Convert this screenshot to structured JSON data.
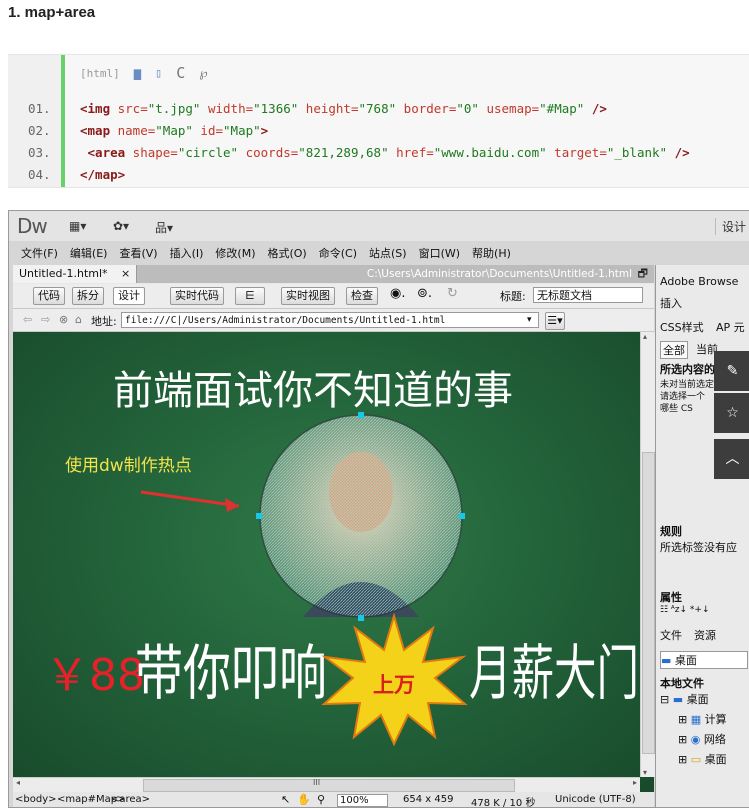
{
  "article": {
    "heading": "1. map+area",
    "code_toolbar": {
      "lang_label": "[html]"
    },
    "code_lines": [
      {
        "num": "01.",
        "parts": [
          [
            "t",
            "<img"
          ],
          [
            "a",
            " src="
          ],
          [
            "v",
            "\"t.jpg\""
          ],
          [
            "a",
            " width="
          ],
          [
            "v",
            "\"1366\""
          ],
          [
            "a",
            " height="
          ],
          [
            "v",
            "\"768\""
          ],
          [
            "a",
            " border="
          ],
          [
            "v",
            "\"0\""
          ],
          [
            "a",
            " usemap="
          ],
          [
            "v",
            "\"#Map\""
          ],
          [
            "t",
            " />"
          ]
        ]
      },
      {
        "num": "02.",
        "parts": [
          [
            "t",
            "<map"
          ],
          [
            "a",
            " name="
          ],
          [
            "v",
            "\"Map\""
          ],
          [
            "a",
            " id="
          ],
          [
            "v",
            "\"Map\""
          ],
          [
            "t",
            ">"
          ]
        ]
      },
      {
        "num": "03.",
        "parts": [
          [
            "t",
            " <area"
          ],
          [
            "a",
            " shape="
          ],
          [
            "v",
            "\"circle\""
          ],
          [
            "a",
            " coords="
          ],
          [
            "v",
            "\"821,289,68\""
          ],
          [
            "a",
            " href="
          ],
          [
            "v",
            "\"www.baidu.com\""
          ],
          [
            "a",
            " target="
          ],
          [
            "v",
            "\"_blank\""
          ],
          [
            "t",
            " />"
          ]
        ]
      },
      {
        "num": "04.",
        "parts": [
          [
            "t",
            "</map>"
          ]
        ]
      }
    ]
  },
  "dw": {
    "logo": "Dw",
    "top_tools": [
      "▦▾",
      "✿▾",
      "品▾"
    ],
    "top_right": "设计",
    "menu": [
      "文件(F)",
      "编辑(E)",
      "查看(V)",
      "插入(I)",
      "修改(M)",
      "格式(O)",
      "命令(C)",
      "站点(S)",
      "窗口(W)",
      "帮助(H)"
    ],
    "doc_tab": "Untitled-1.html*",
    "doc_tab_close": "×",
    "doc_path": "C:\\Users\\Administrator\\Documents\\Untitled-1.html",
    "view_buttons": [
      "代码",
      "拆分",
      "设计",
      "实时代码",
      "实时视图",
      "检查"
    ],
    "title_label": "标题:",
    "title_value": "无标题文档",
    "address_label": "地址:",
    "address_value": "file:///C|/Users/Administrator/Documents/Untitled-1.html",
    "canvas": {
      "headline": "前端面试你不知道的事",
      "hint": "使用dw制作热点",
      "price": "￥88",
      "slogan_a": "带你叩响",
      "burst": "上万",
      "slogan_b": "月薪大门"
    },
    "status": {
      "tags": [
        "<body>",
        "<map#Map>",
        "<area>"
      ],
      "zoom": "100%",
      "dims": "654 x 459",
      "size": "478 K / 10 秒",
      "encoding": "Unicode (UTF-8)",
      "scroll_mark": "III"
    },
    "side": {
      "title": "Adobe Browse",
      "insert": "插入",
      "css_tab": "CSS样式",
      "ap_tab": "AP 元",
      "all": "全部",
      "current": "当前",
      "selected": "所选内容的摘要",
      "nodef": "未对当前选定内容",
      "pick": "请选择一个",
      "which": "哪些 CS",
      "rules": "规则",
      "rules_text": "所选标签没有应",
      "props": "属性",
      "files_tab": "文件",
      "assets_tab": "资源",
      "desktop": "桌面",
      "local_files": "本地文件",
      "tree": [
        "桌面",
        "计算",
        "网络",
        "桌面"
      ]
    }
  }
}
